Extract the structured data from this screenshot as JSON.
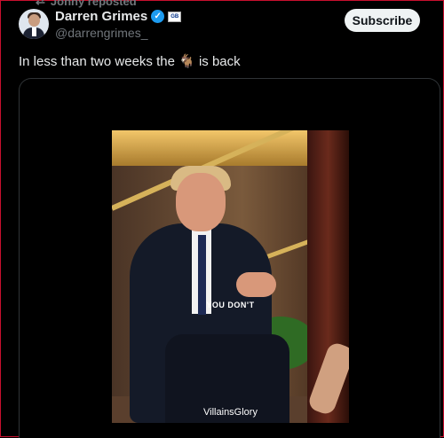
{
  "repost": {
    "label": "Jonny reposted"
  },
  "author": {
    "name": "Darren Grimes",
    "handle": "@darrengrimes_",
    "affiliation": "GB"
  },
  "subscribe": {
    "label": "Subscribe"
  },
  "tweet": {
    "text_before": "In less than two weeks the",
    "emoji": "🐐",
    "text_after": "is back"
  },
  "video": {
    "caption": "YOU DON'T",
    "watermark": "VillainsGlory"
  },
  "colors": {
    "accent": "#1d9bf0",
    "subscribe_bg": "#eff3f4",
    "frame_border": "#c8102e"
  },
  "icons": {
    "repost": "repost-icon",
    "verified": "verified-badge-icon"
  }
}
